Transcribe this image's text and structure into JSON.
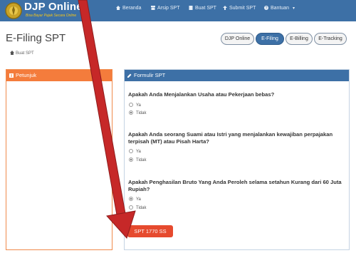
{
  "app": {
    "brand": "DJP Online",
    "tagline": "Bisa Bayar Pajak Secara Online",
    "accent_blue": "#3d70a6",
    "accent_orange": "#f47c3c",
    "button_red": "#e64a2e",
    "arrow_red": "#c62828"
  },
  "nav": {
    "items": [
      {
        "label": "Beranda",
        "icon": "home-icon"
      },
      {
        "label": "Arsip SPT",
        "icon": "archive-icon"
      },
      {
        "label": "Buat SPT",
        "icon": "document-icon"
      },
      {
        "label": "Submit SPT",
        "icon": "upload-icon"
      },
      {
        "label": "Bantuan",
        "icon": "help-icon"
      }
    ]
  },
  "page": {
    "title": "E-Filing SPT",
    "breadcrumb": "Buat SPT"
  },
  "tabs": [
    {
      "label": "DJP Online",
      "active": false
    },
    {
      "label": "E-Filing",
      "active": true
    },
    {
      "label": "E-Billing",
      "active": false
    },
    {
      "label": "E-Tracking",
      "active": false
    }
  ],
  "left_panel": {
    "title": "Petunjuk"
  },
  "form": {
    "title": "Formulir SPT",
    "questions": [
      {
        "text": "Apakah Anda Menjalankan Usaha atau Pekerjaan bebas?",
        "options": [
          {
            "label": "Ya",
            "selected": false
          },
          {
            "label": "Tidak",
            "selected": true
          }
        ]
      },
      {
        "text": "Apakah Anda seorang Suami atau Istri yang menjalankan kewajiban perpajakan terpisah (MT) atau Pisah Harta?",
        "options": [
          {
            "label": "Ya",
            "selected": false
          },
          {
            "label": "Tidak",
            "selected": true
          }
        ]
      },
      {
        "text": "Apakah Penghasilan Bruto Yang Anda Peroleh selama setahun Kurang dari 60 Juta Rupiah?",
        "options": [
          {
            "label": "Ya",
            "selected": true
          },
          {
            "label": "Tidak",
            "selected": false
          }
        ]
      }
    ],
    "submit_label": "SPT 1770 SS"
  }
}
